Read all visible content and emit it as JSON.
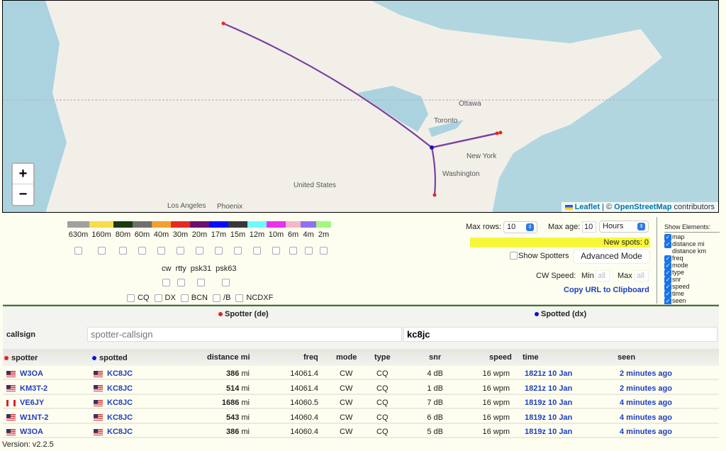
{
  "map": {
    "zoom_in": "+",
    "zoom_out": "−",
    "labels": {
      "ottawa": "Ottawa",
      "toronto": "Toronto",
      "newyork": "New York",
      "washington": "Washington",
      "us": "United States",
      "phoenix": "Phoenix",
      "la": "Los Angeles"
    },
    "attribution": {
      "leaflet": "Leaflet",
      "sep": " | © ",
      "osm": "OpenStreetMap",
      "suffix": " contributors"
    },
    "colors": {
      "path": "#7b3f9e",
      "spotter": "#e8231f",
      "spotted": "#1010d0",
      "water": "#aad3df"
    }
  },
  "bands": [
    {
      "label": "630m",
      "color": "#a0a0a0",
      "w": 31
    },
    {
      "label": "160m",
      "color": "#f9dc4a",
      "w": 34
    },
    {
      "label": "80m",
      "color": "#1a3a10",
      "w": 27
    },
    {
      "label": "60m",
      "color": "#6f6f6f",
      "w": 27
    },
    {
      "label": "40m",
      "color": "#f0a030",
      "w": 27
    },
    {
      "label": "30m",
      "color": "#e52a22",
      "w": 27
    },
    {
      "label": "20m",
      "color": "#6a1070",
      "w": 27
    },
    {
      "label": "17m",
      "color": "#0010ff",
      "w": 27
    },
    {
      "label": "15m",
      "color": "#383838",
      "w": 27
    },
    {
      "label": "12m",
      "color": "#6ffaff",
      "w": 27
    },
    {
      "label": "10m",
      "color": "#e832f0",
      "w": 27
    },
    {
      "label": "6m",
      "color": "#f3b8c8",
      "w": 21
    },
    {
      "label": "4m",
      "color": "#9070f0",
      "w": 22
    },
    {
      "label": "2m",
      "color": "#a0f880",
      "w": 21
    }
  ],
  "modes": [
    "cw",
    "rtty",
    "psk31",
    "psk63"
  ],
  "types": [
    "CQ",
    "DX",
    "BCN",
    "/B",
    "NCDXF"
  ],
  "controls": {
    "max_rows_label": "Max rows:",
    "max_rows": "10",
    "max_age_label": "Max age:",
    "max_age": "10",
    "age_unit": "Hours",
    "new_spots": "New spots: 0",
    "show_spotters": "Show Spotters",
    "advanced": "Advanced Mode",
    "cw_speed": "CW Speed:",
    "min": "Min",
    "max": "Max",
    "min_ph": "all",
    "max_ph": "all",
    "copy_url": "Copy URL to Clipboard"
  },
  "show_elements": {
    "title": "Show Elements:",
    "items": [
      {
        "label": "map",
        "on": true
      },
      {
        "label": "distance mi",
        "on": true
      },
      {
        "label": "distance km",
        "on": false
      },
      {
        "label": "freq",
        "on": true
      },
      {
        "label": "mode",
        "on": true
      },
      {
        "label": "type",
        "on": true
      },
      {
        "label": "snr",
        "on": true
      },
      {
        "label": "speed",
        "on": true
      },
      {
        "label": "time",
        "on": true
      },
      {
        "label": "seen",
        "on": true
      }
    ]
  },
  "filter": {
    "spotter_head": "Spotter (de)",
    "spotted_head": "Spotted (dx)",
    "callsign_label": "callsign",
    "spotter_placeholder": "spotter-callsign",
    "spotted_value": "kc8jc"
  },
  "table": {
    "headers": {
      "spotter": "spotter",
      "spotted": "spotted",
      "distance": "distance mi",
      "freq": "freq",
      "mode": "mode",
      "type": "type",
      "snr": "snr",
      "speed": "speed",
      "time": "time",
      "seen": "seen"
    },
    "rows": [
      {
        "flag": "us",
        "spotter": "W3OA",
        "spotted": "KC8JC",
        "dist": "386",
        "unit": "mi",
        "freq": "14061.4",
        "mode": "CW",
        "type": "CQ",
        "snr": "4 dB",
        "speed": "16 wpm",
        "time": "1821z 10 Jan",
        "seen": "2 minutes ago"
      },
      {
        "flag": "us",
        "spotter": "KM3T-2",
        "spotted": "KC8JC",
        "dist": "514",
        "unit": "mi",
        "freq": "14061.4",
        "mode": "CW",
        "type": "CQ",
        "snr": "1 dB",
        "speed": "16 wpm",
        "time": "1821z 10 Jan",
        "seen": "2 minutes ago"
      },
      {
        "flag": "ca",
        "spotter": "VE6JY",
        "spotted": "KC8JC",
        "dist": "1686",
        "unit": "mi",
        "freq": "14060.5",
        "mode": "CW",
        "type": "CQ",
        "snr": "7 dB",
        "speed": "16 wpm",
        "time": "1819z 10 Jan",
        "seen": "4 minutes ago"
      },
      {
        "flag": "us",
        "spotter": "W1NT-2",
        "spotted": "KC8JC",
        "dist": "543",
        "unit": "mi",
        "freq": "14060.4",
        "mode": "CW",
        "type": "CQ",
        "snr": "6 dB",
        "speed": "16 wpm",
        "time": "1819z 10 Jan",
        "seen": "4 minutes ago"
      },
      {
        "flag": "us",
        "spotter": "W3OA",
        "spotted": "KC8JC",
        "dist": "386",
        "unit": "mi",
        "freq": "14060.4",
        "mode": "CW",
        "type": "CQ",
        "snr": "5 dB",
        "speed": "16 wpm",
        "time": "1819z 10 Jan",
        "seen": "4 minutes ago"
      }
    ]
  },
  "version": "Version: v2.2.5"
}
